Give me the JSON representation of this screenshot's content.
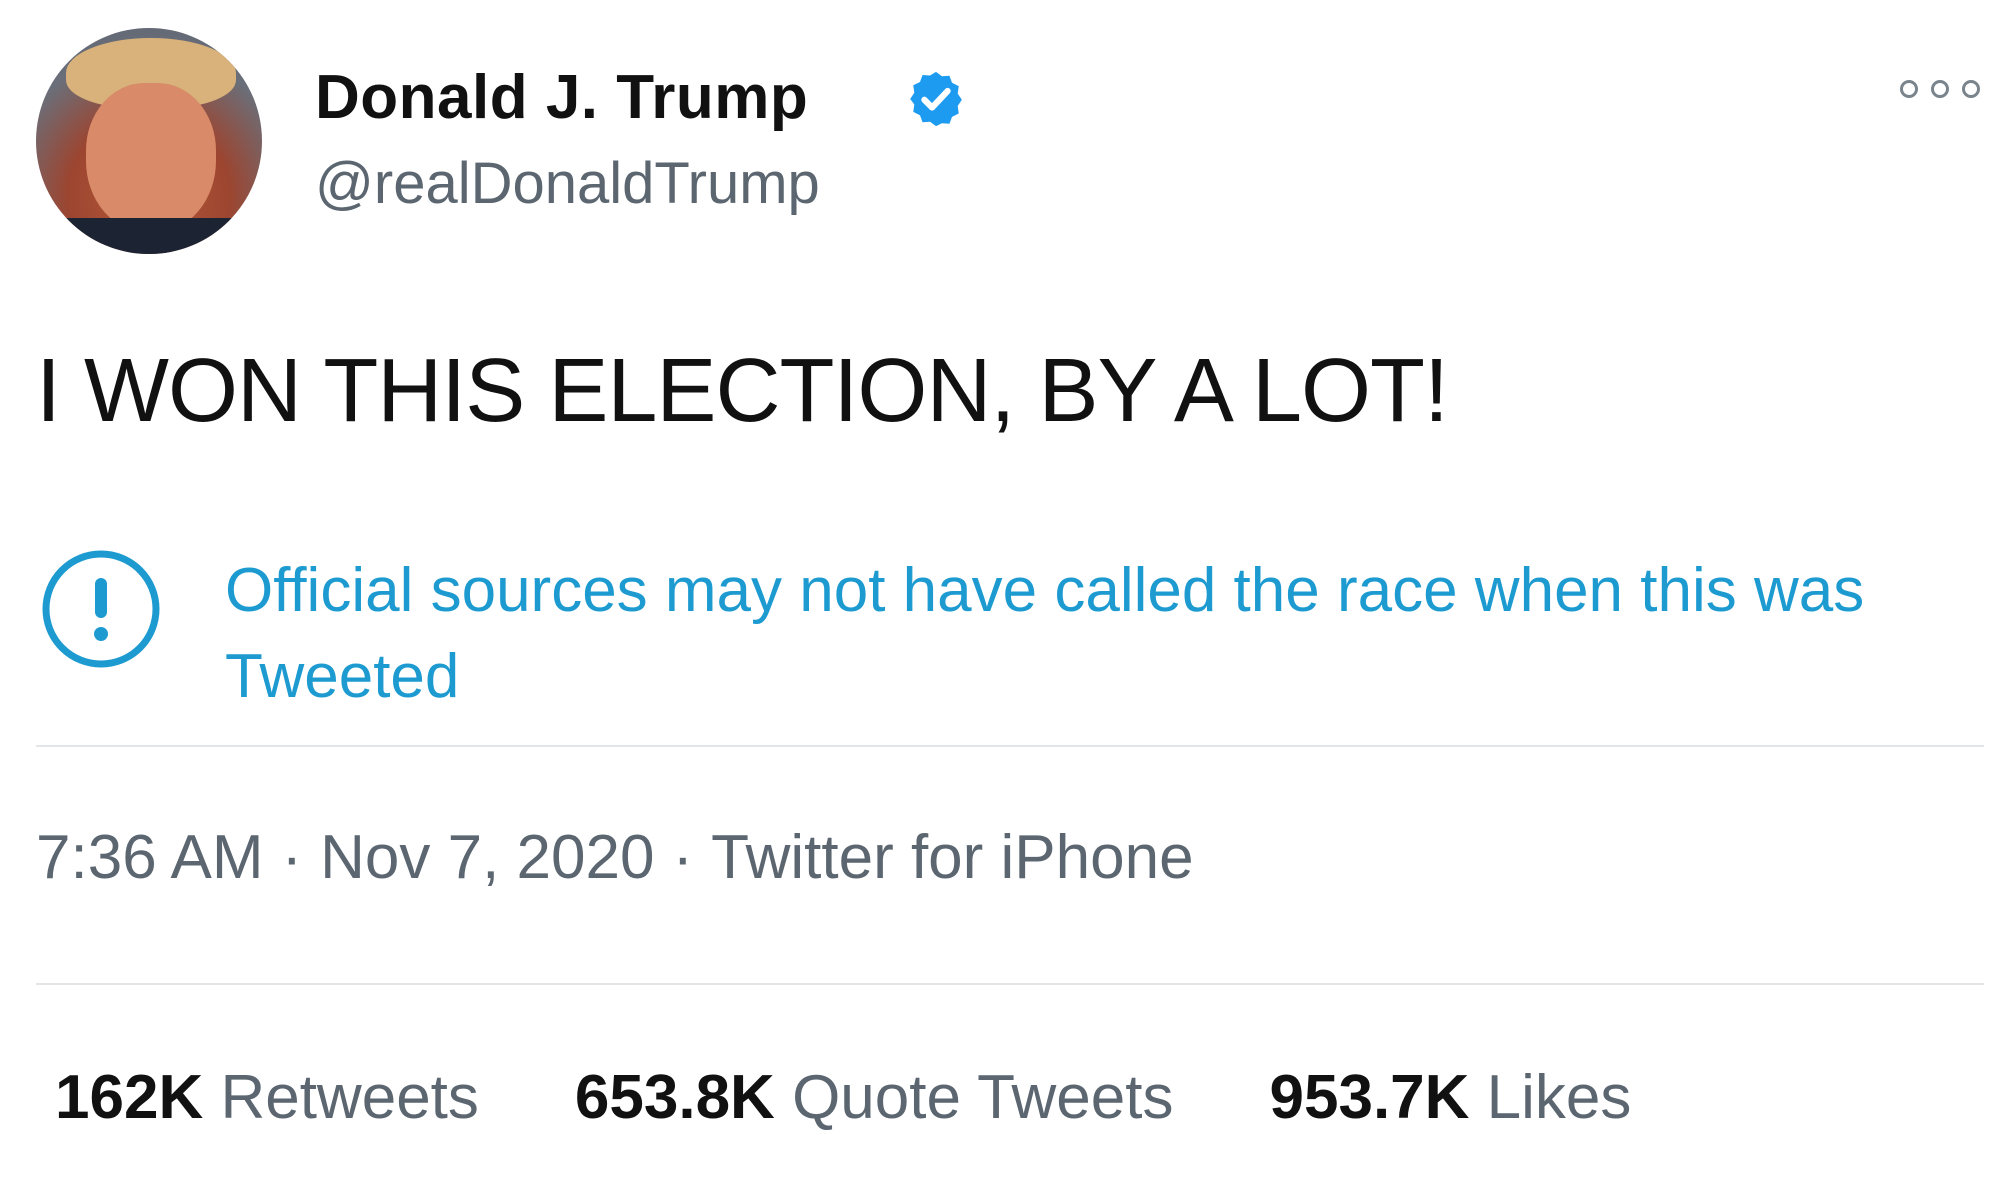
{
  "tweet": {
    "author": {
      "display_name": "Donald J. Trump",
      "handle": "@realDonaldTrump",
      "verified": true,
      "verified_icon": "verified-badge-icon",
      "avatar_icon": "profile-photo"
    },
    "more_icon": "more-options-icon",
    "text": "I WON THIS ELECTION, BY A LOT!",
    "notice": {
      "icon": "exclamation-circle-icon",
      "text": "Official sources may not have called the race when this was Tweeted"
    },
    "meta": {
      "time": "7:36 AM",
      "separator": "·",
      "date": "Nov 7, 2020",
      "source": "Twitter for iPhone"
    },
    "stats": {
      "retweets_count": "162K",
      "retweets_label": "Retweets",
      "quotes_count": "653.8K",
      "quotes_label": "Quote Tweets",
      "likes_count": "953.7K",
      "likes_label": "Likes"
    }
  },
  "colors": {
    "accent": "#1d9bd1",
    "verified": "#1d9bf0",
    "text_primary": "#111111",
    "text_secondary": "#5b6670",
    "divider": "#e3e6e8",
    "background": "#ffffff"
  }
}
